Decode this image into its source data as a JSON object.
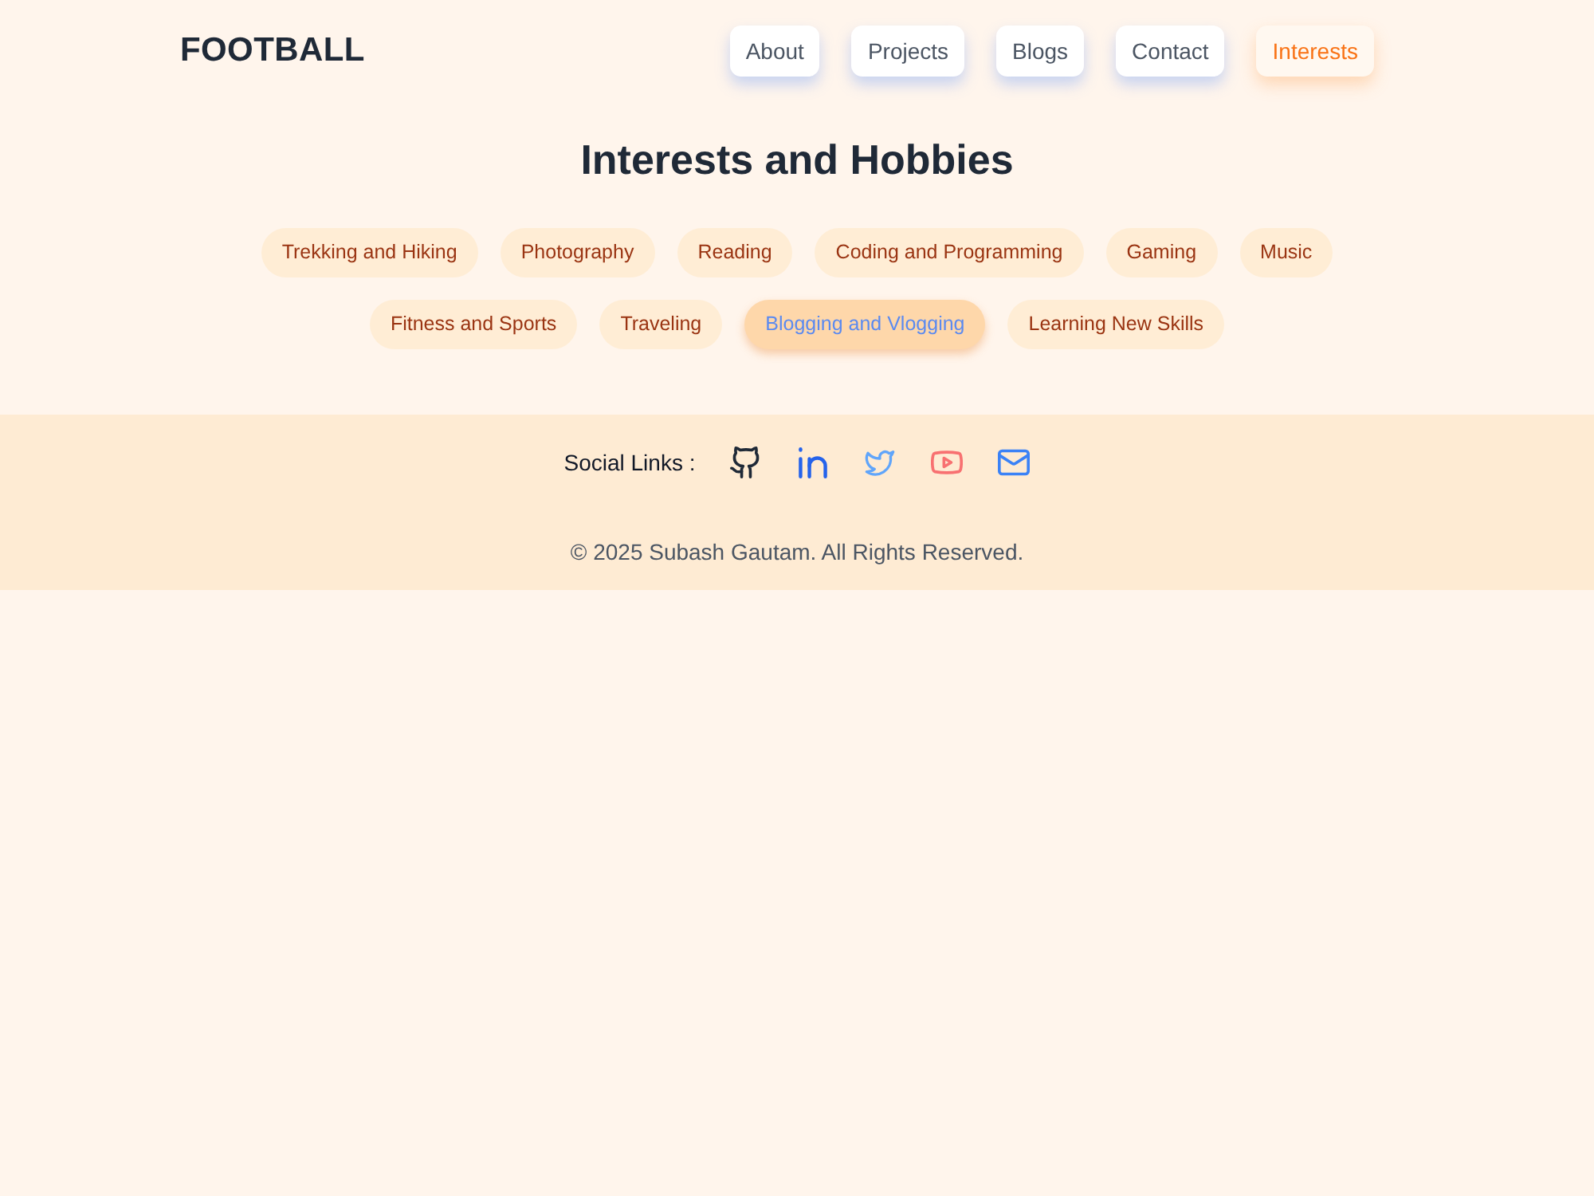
{
  "header": {
    "logo": "FOOTBALL",
    "nav": [
      {
        "label": "About",
        "selected": false
      },
      {
        "label": "Projects",
        "selected": false
      },
      {
        "label": "Blogs",
        "selected": false
      },
      {
        "label": "Contact",
        "selected": false
      },
      {
        "label": "Interests",
        "selected": true
      }
    ]
  },
  "interests": {
    "title": "Interests and Hobbies",
    "tags": [
      {
        "label": "Trekking and Hiking",
        "selected": false
      },
      {
        "label": "Photography",
        "selected": false
      },
      {
        "label": "Reading",
        "selected": false
      },
      {
        "label": "Coding and Programming",
        "selected": false
      },
      {
        "label": "Gaming",
        "selected": false
      },
      {
        "label": "Music",
        "selected": false
      },
      {
        "label": "Fitness and Sports",
        "selected": false
      },
      {
        "label": "Traveling",
        "selected": false
      },
      {
        "label": "Blogging and Vlogging",
        "selected": true
      },
      {
        "label": "Learning New Skills",
        "selected": false
      }
    ]
  },
  "footer": {
    "social_label": "Social Links :",
    "social_links": [
      {
        "kind": "github",
        "color": "#1f2937"
      },
      {
        "kind": "linkedin",
        "color": "#2563eb"
      },
      {
        "kind": "twitter",
        "color": "#60a5fa"
      },
      {
        "kind": "youtube",
        "color": "#f87171"
      },
      {
        "kind": "mail",
        "color": "#3b82f6"
      }
    ],
    "copyright": "© 2025 Subash Gautam. All Rights Reserved."
  }
}
